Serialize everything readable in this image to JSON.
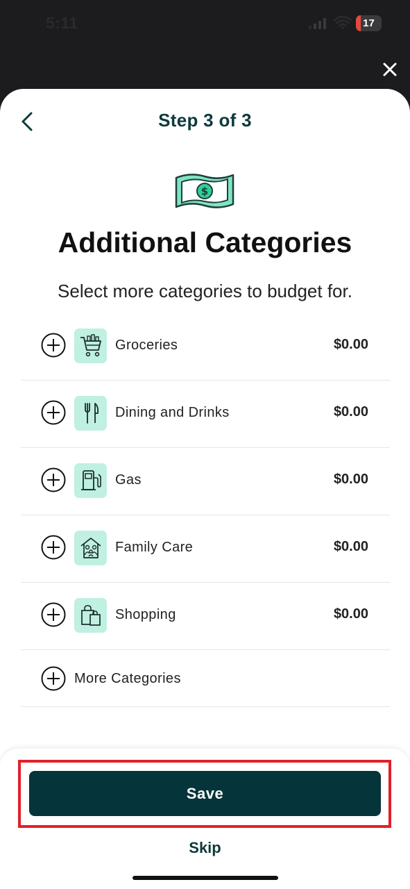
{
  "status_bar": {
    "time": "5:11",
    "battery_level": "17",
    "signal_icon": "cellular-signal-icon",
    "wifi_icon": "wifi-icon"
  },
  "header": {
    "title": "Step 3 of 3",
    "back_icon": "chevron-left-icon",
    "close_icon": "close-icon"
  },
  "hero": {
    "icon": "money-bill-icon",
    "title": "Additional Categories",
    "subtitle": "Select more categories to budget for."
  },
  "categories": [
    {
      "label": "Groceries",
      "amount": "$0.00",
      "icon": "shopping-cart-icon"
    },
    {
      "label": "Dining and Drinks",
      "amount": "$0.00",
      "icon": "fork-knife-icon"
    },
    {
      "label": "Gas",
      "amount": "$0.00",
      "icon": "gas-pump-icon"
    },
    {
      "label": "Family Care",
      "amount": "$0.00",
      "icon": "family-home-icon"
    },
    {
      "label": "Shopping",
      "amount": "$0.00",
      "icon": "shopping-bags-icon"
    }
  ],
  "more_categories": {
    "label": "More Categories",
    "icon": "plus-circle-icon"
  },
  "footer": {
    "save_label": "Save",
    "skip_label": "Skip"
  },
  "colors": {
    "primary_dark": "#05343a",
    "accent_mint": "#bff0e1",
    "highlight_red": "#e0202b"
  }
}
